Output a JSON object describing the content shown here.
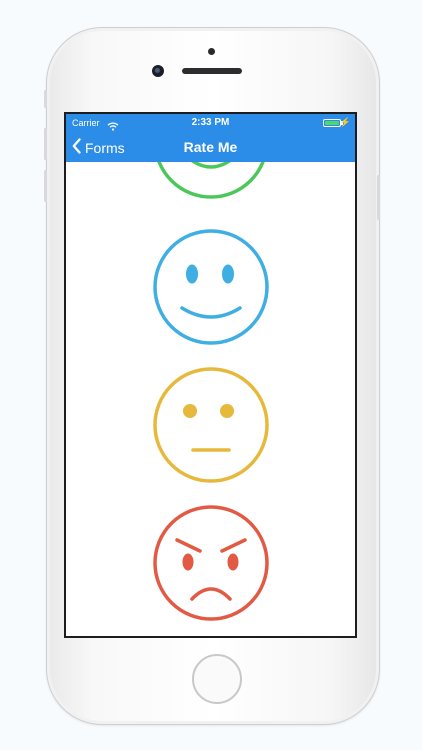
{
  "status_bar": {
    "carrier": "Carrier",
    "time": "2:33 PM",
    "icons": [
      "wifi-icon",
      "battery-icon",
      "charging-bolt-icon"
    ],
    "battery_color": "#4cd964"
  },
  "nav": {
    "back_label": "Forms",
    "title": "Rate Me",
    "background": "#2c8de9"
  },
  "ratings": [
    {
      "name": "very-happy",
      "icon": "grinning-face-icon",
      "color": "#4cc85a"
    },
    {
      "name": "happy",
      "icon": "smiling-face-icon",
      "color": "#3eaee3"
    },
    {
      "name": "neutral",
      "icon": "neutral-face-icon",
      "color": "#e6b93c"
    },
    {
      "name": "angry",
      "icon": "angry-face-icon",
      "color": "#e25a43"
    }
  ]
}
